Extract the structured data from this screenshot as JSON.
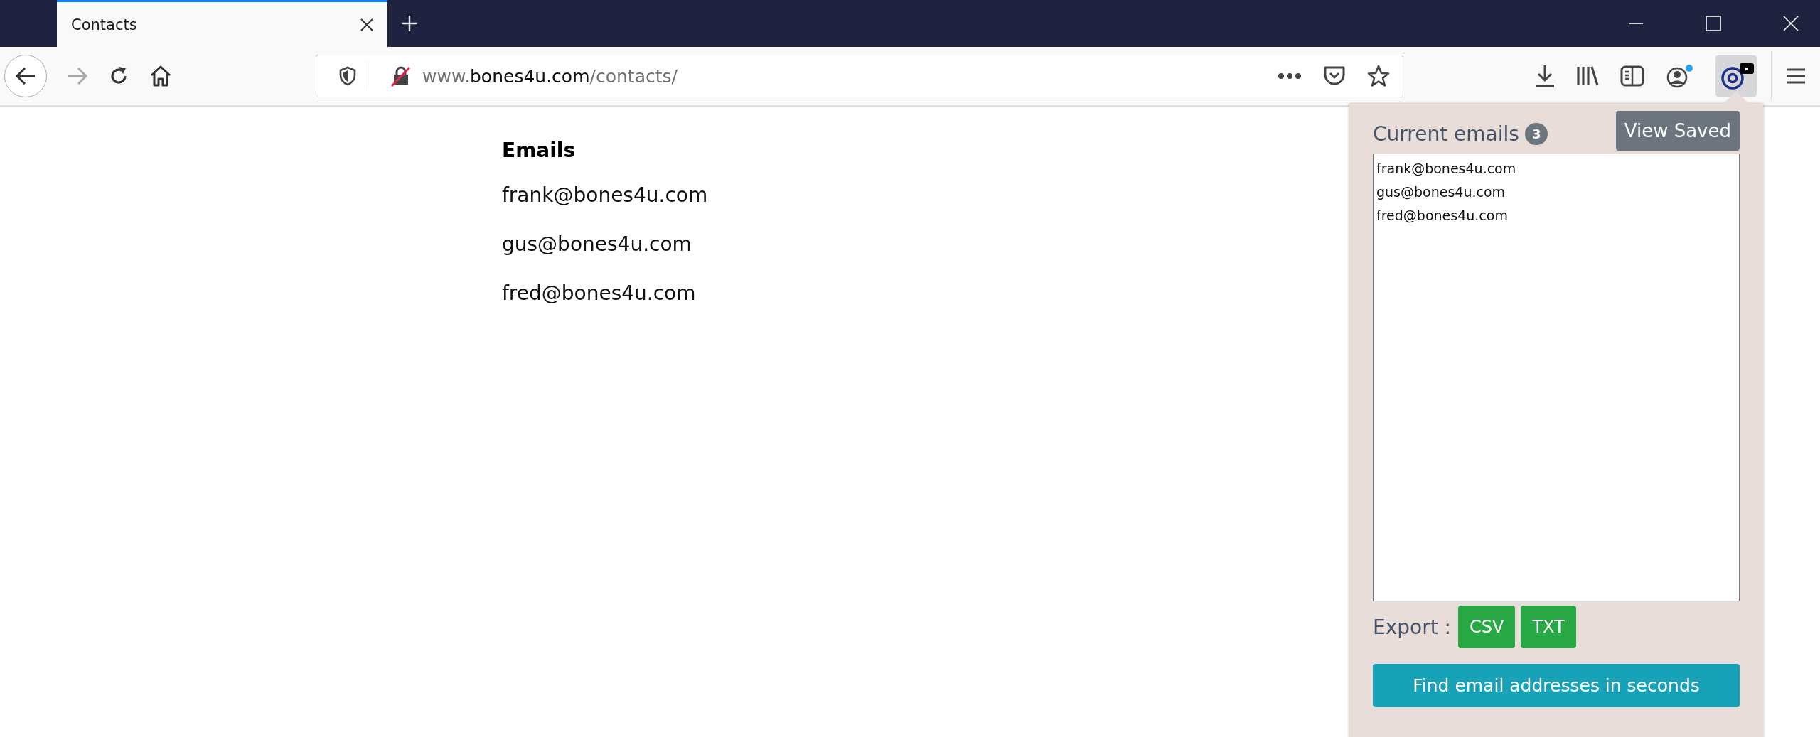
{
  "tabs": [
    {
      "title": "Contacts",
      "selected": true
    }
  ],
  "address_bar": {
    "url_parts": [
      {
        "text": "www.",
        "kind": "dim"
      },
      {
        "text": "bones4u.com",
        "kind": "host"
      },
      {
        "text": "/contacts/",
        "kind": "dim"
      }
    ]
  },
  "page": {
    "heading": "Emails",
    "emails": [
      "frank@bones4u.com",
      "gus@bones4u.com",
      "fred@bones4u.com"
    ]
  },
  "popup": {
    "title": "Current emails",
    "count": "3",
    "view_saved": "View Saved",
    "emails_box": "frank@bones4u.com\ngus@bones4u.com\nfred@bones4u.com",
    "export_label": "Export :",
    "export_buttons": [
      "CSV",
      "TXT"
    ],
    "find_button": "Find email addresses in seconds"
  }
}
